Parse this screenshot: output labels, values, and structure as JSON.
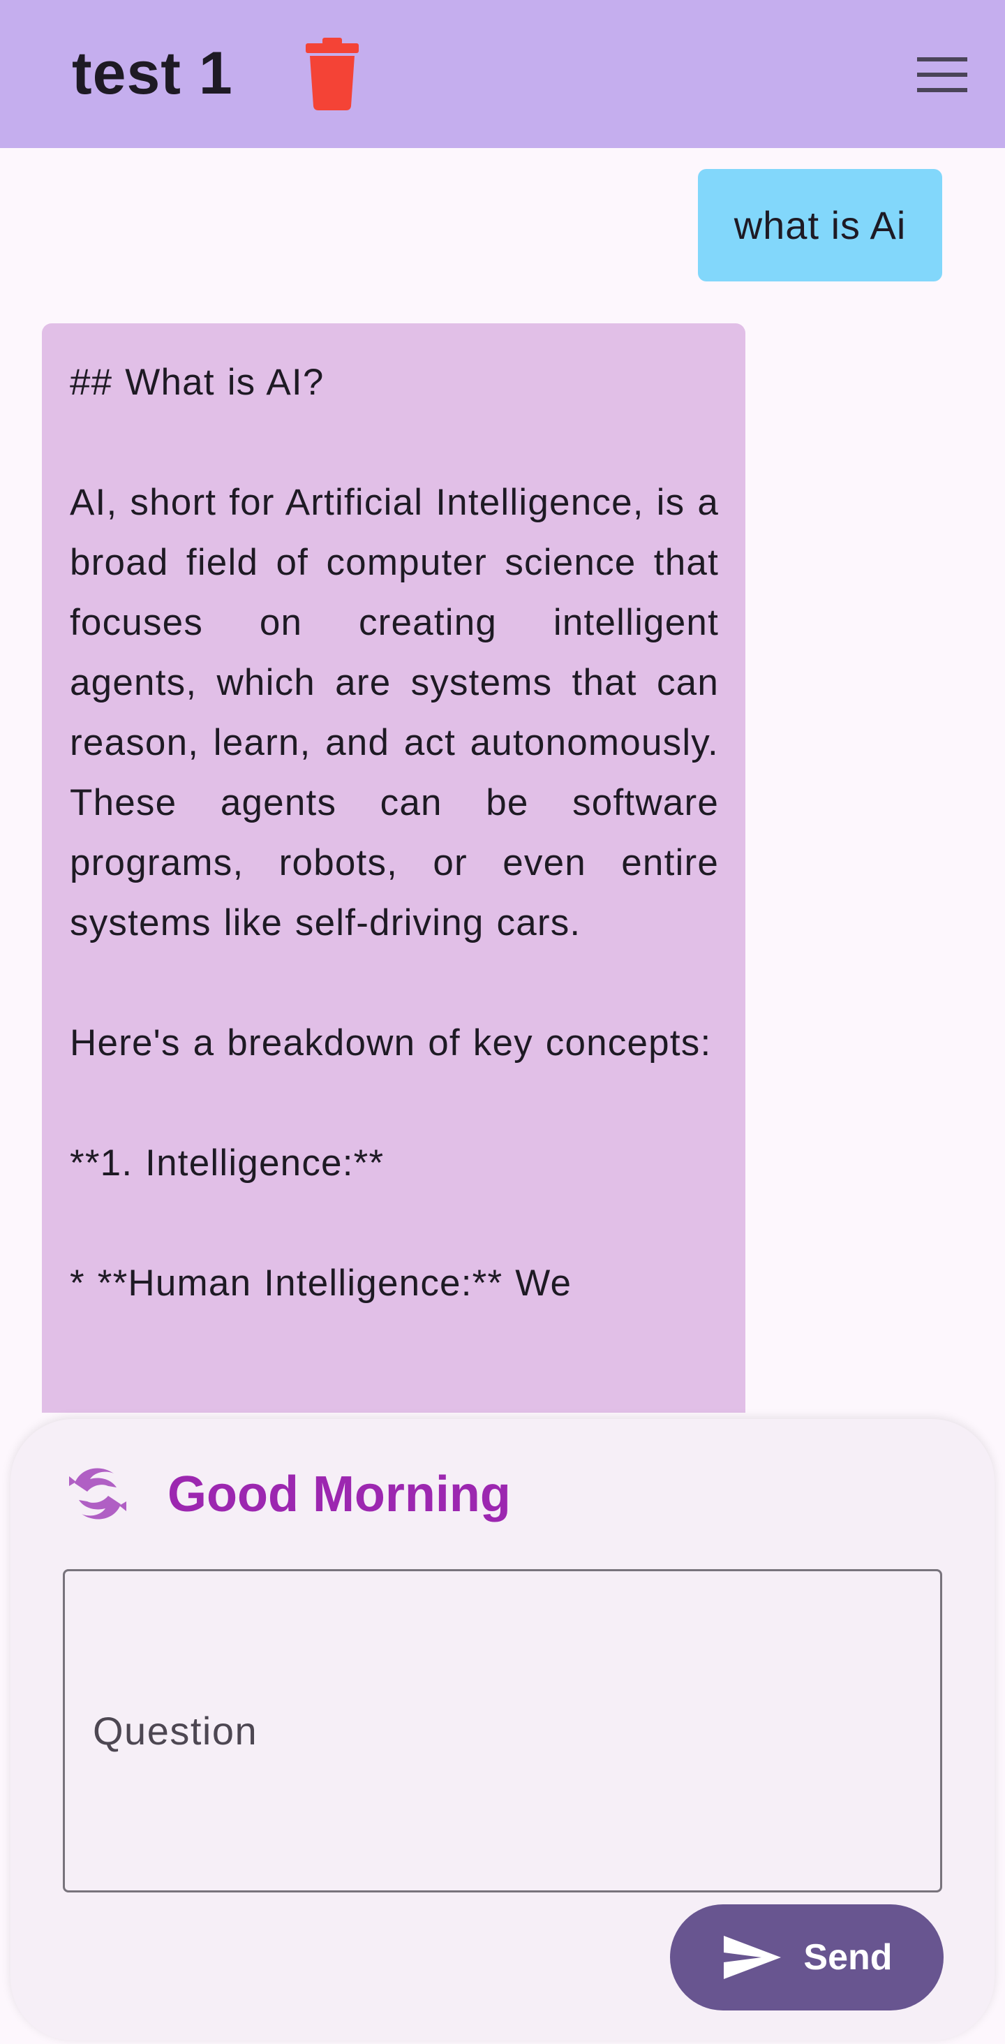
{
  "appbar": {
    "title": "test 1",
    "delete_icon": "trash-icon",
    "menu_icon": "hamburger-menu-icon",
    "background": "#c5aeee"
  },
  "chat": {
    "user_message": "what is Ai",
    "user_bubble_color": "#82d7fb",
    "ai_bubble_color": "#e1bfe7",
    "ai_message": "## What is AI?\n\nAI, short for Artificial Intelligence, is a broad field of computer science that focuses on creating intelligent agents, which are systems that can reason, learn, and act autonomously. These agents can be software programs, robots, or even entire systems like self-driving cars.\n\nHere's a breakdown of key concepts:\n\n**1. Intelligence:**\n\n* **Human Intelligence:** We"
  },
  "composer": {
    "logo_icon": "dolphin-logo-icon",
    "greeting": "Good Morning",
    "greeting_color": "#9c27b0",
    "input_value": "",
    "input_placeholder": "Question",
    "send_icon": "send-icon",
    "send_label": "Send",
    "send_color": "#685590"
  }
}
